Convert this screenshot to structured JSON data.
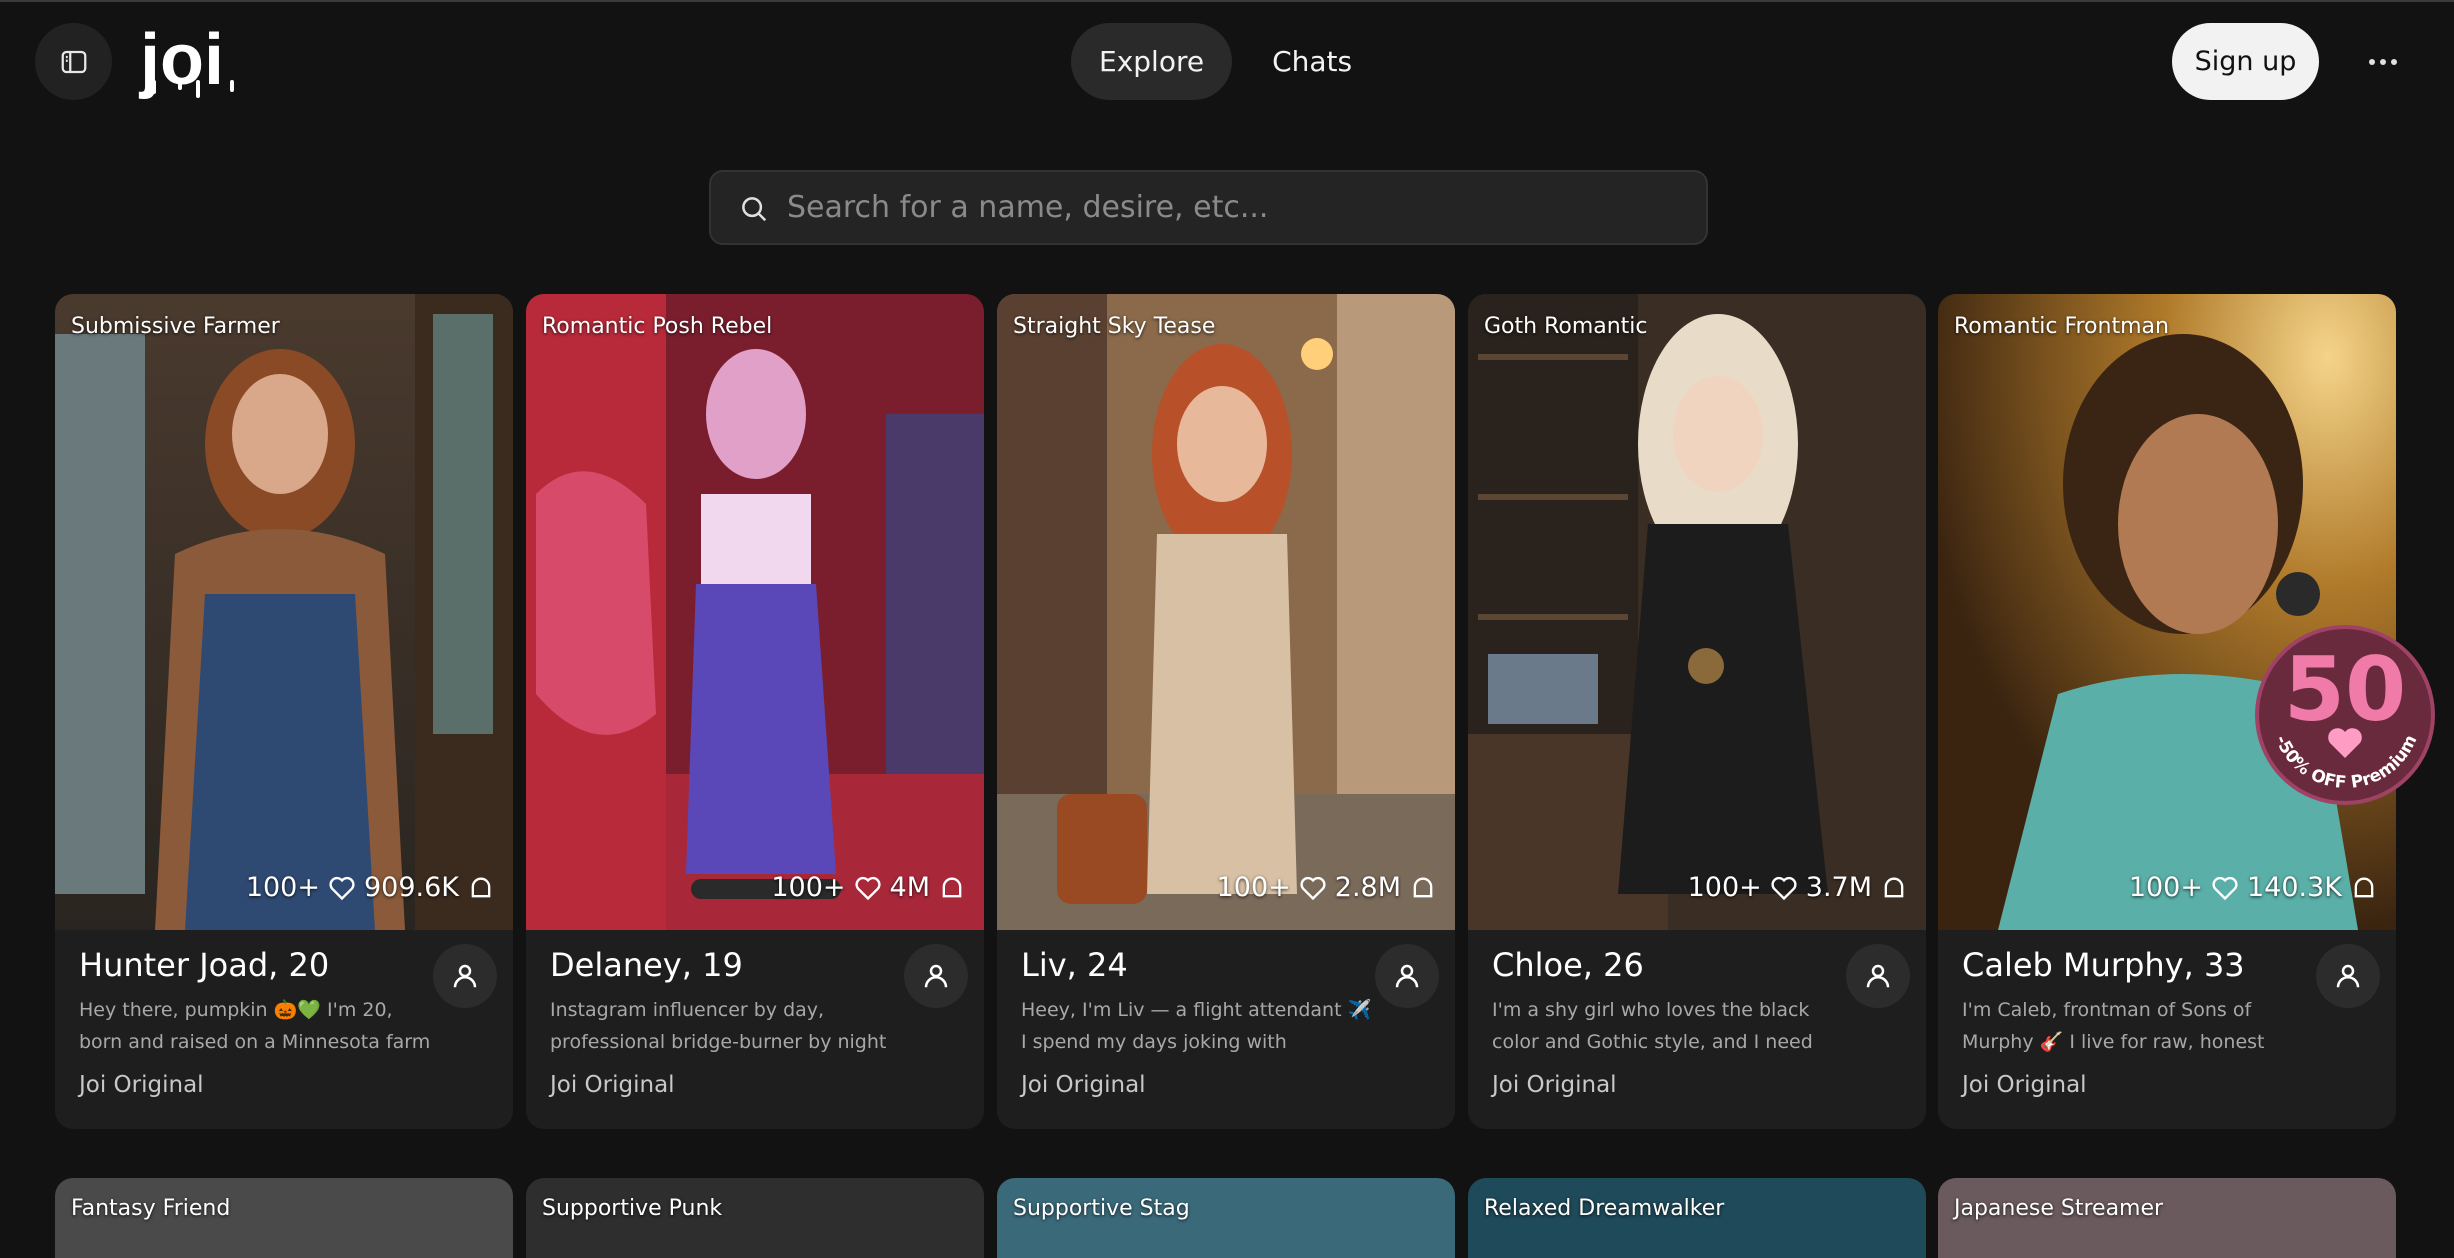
{
  "header": {
    "logo_text": "joi",
    "nav": [
      {
        "label": "Explore",
        "active": true
      },
      {
        "label": "Chats",
        "active": false
      }
    ],
    "signup_label": "Sign up",
    "more_icon": "more-horizontal-icon",
    "sidebar_icon": "sidebar-toggle-icon"
  },
  "search": {
    "placeholder": "Search for a name, desire, etc..."
  },
  "cards": [
    {
      "tag": "Submissive Farmer",
      "likes": "100+",
      "chats": "909.6K",
      "name": "Hunter Joad, 20",
      "desc": "Hey there, pumpkin 🎃💚 I'm 20, born and raised on a Minnesota farm —...",
      "source": "Joi Original"
    },
    {
      "tag": "Romantic Posh Rebel",
      "likes": "100+",
      "chats": "4M",
      "name": "Delaney, 19",
      "desc": "Instagram influencer by day, professional bridge-burner by night ...",
      "source": "Joi Original"
    },
    {
      "tag": "Straight Sky Tease",
      "likes": "100+",
      "chats": "2.8M",
      "name": "Liv, 24",
      "desc": "Heey, I'm Liv — a flight attendant ✈️ I spend my days joking with passenger...",
      "source": "Joi Original"
    },
    {
      "tag": "Goth Romantic",
      "likes": "100+",
      "chats": "3.7M",
      "name": "Chloe, 26",
      "desc": "I'm a shy girl who loves the black color and Gothic style, and I need someone...",
      "source": "Joi Original"
    },
    {
      "tag": "Romantic Frontman",
      "likes": "100+",
      "chats": "140.3K",
      "name": "Caleb Murphy, 33",
      "desc": "I'm Caleb, frontman of Sons of Murphy 🎸 I live for raw, honest music that hit...",
      "source": "Joi Original"
    }
  ],
  "promo": {
    "number": "50",
    "text": "-50% OFF Premium"
  },
  "second_row": [
    {
      "tag": "Fantasy Friend"
    },
    {
      "tag": "Supportive Punk"
    },
    {
      "tag": "Supportive Stag"
    },
    {
      "tag": "Relaxed Dreamwalker"
    },
    {
      "tag": "Japanese Streamer"
    }
  ],
  "colors": {
    "background": "#121212",
    "card": "#1e1e1e",
    "promo_pink": "#f07aa8"
  }
}
